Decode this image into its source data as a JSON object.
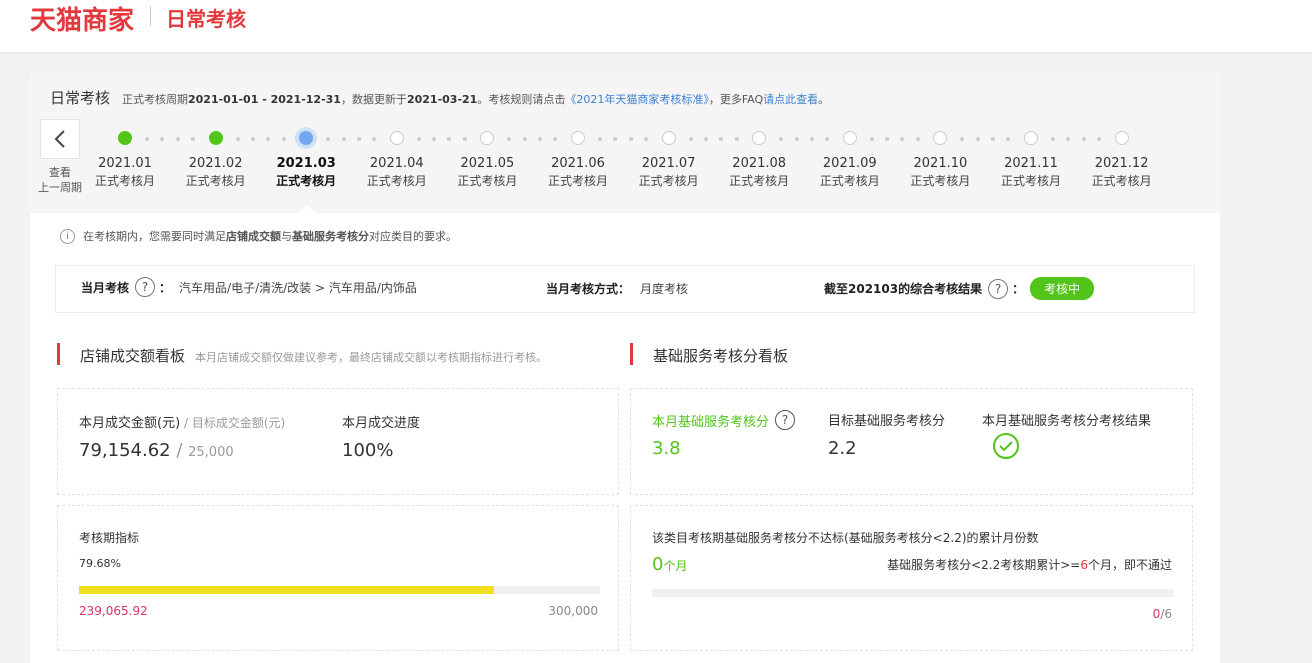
{
  "header": {
    "brand": "天猫商家",
    "section": "日常考核"
  },
  "period": {
    "title": "日常考核",
    "p1": "正式考核周期",
    "range": "2021-01-01 - 2021-12-31",
    "p2": "，数据更新于",
    "updated": "2021-03-21",
    "p3": "。考核规则请点击",
    "rule_link": "《2021年天猫商家考核标准》",
    "p4": "，更多FAQ",
    "faq_link": "请点此查看",
    "p5": "。"
  },
  "timeline": {
    "prev_label_1": "查看",
    "prev_label_2": "上一周期",
    "months": [
      {
        "label": "2021.01",
        "sub": "正式考核月",
        "status": "done"
      },
      {
        "label": "2021.02",
        "sub": "正式考核月",
        "status": "done"
      },
      {
        "label": "2021.03",
        "sub": "正式考核月",
        "status": "current"
      },
      {
        "label": "2021.04",
        "sub": "正式考核月",
        "status": "todo"
      },
      {
        "label": "2021.05",
        "sub": "正式考核月",
        "status": "todo"
      },
      {
        "label": "2021.06",
        "sub": "正式考核月",
        "status": "todo"
      },
      {
        "label": "2021.07",
        "sub": "正式考核月",
        "status": "todo"
      },
      {
        "label": "2021.08",
        "sub": "正式考核月",
        "status": "todo"
      },
      {
        "label": "2021.09",
        "sub": "正式考核月",
        "status": "todo"
      },
      {
        "label": "2021.10",
        "sub": "正式考核月",
        "status": "todo"
      },
      {
        "label": "2021.11",
        "sub": "正式考核月",
        "status": "todo"
      },
      {
        "label": "2021.12",
        "sub": "正式考核月",
        "status": "todo"
      }
    ]
  },
  "notice": {
    "icon": "i",
    "p1": "在考核期内，您需要同时满足",
    "b1": "店铺成交额",
    "p2": "与",
    "b2": "基础服务考核分",
    "p3": "对应类目的要求。"
  },
  "summary": {
    "month_label": "当月考核",
    "q": "?",
    "colon": "：",
    "category": "汽车用品/电子/清洗/改装 > 汽车用品/内饰品",
    "method_label": "当月考核方式：",
    "method_value": "月度考核",
    "result_label": "截至202103的综合考核结果",
    "result_badge": "考核中"
  },
  "gmv": {
    "title": "店铺成交额看板",
    "desc": "本月店铺成交额仅做建议参考，最终店铺成交额以考核期指标进行考核。",
    "month_amount_label": "本月成交金额(元)",
    "slash": " / ",
    "target_label": "目标成交金额(元)",
    "month_amount": "79,154.62",
    "target_amount": "25,000",
    "progress_label": "本月成交进度",
    "progress_value": "100%",
    "period_label": "考核期指标",
    "period_percent": "79.68%",
    "period_fraction": 0.7968,
    "period_current": "239,065.92",
    "period_target": "300,000"
  },
  "service": {
    "title": "基础服务考核分看板",
    "score_label": "本月基础服务考核分",
    "score_value": "3.8",
    "target_label": "目标基础服务考核分",
    "target_value": "2.2",
    "result_label": "本月基础服务考核分考核结果",
    "months_label": "该类目考核期基础服务考核分不达标(基础服务考核分<2.2)的累计月份数",
    "months_value": "0",
    "months_unit": "个月",
    "rule_p1": "基础服务考核分<2.2考核期累计>=",
    "rule_num": "6",
    "rule_p2": "个月，即不通过",
    "count_current": "0",
    "count_sep": "/6",
    "fraction": 0
  },
  "colors": {
    "brand_red": "#e4393c",
    "success_green": "#52c41a",
    "link_blue": "#3e7fd3",
    "progress_yellow": "#f0e020",
    "count_red": "#d6336c"
  }
}
